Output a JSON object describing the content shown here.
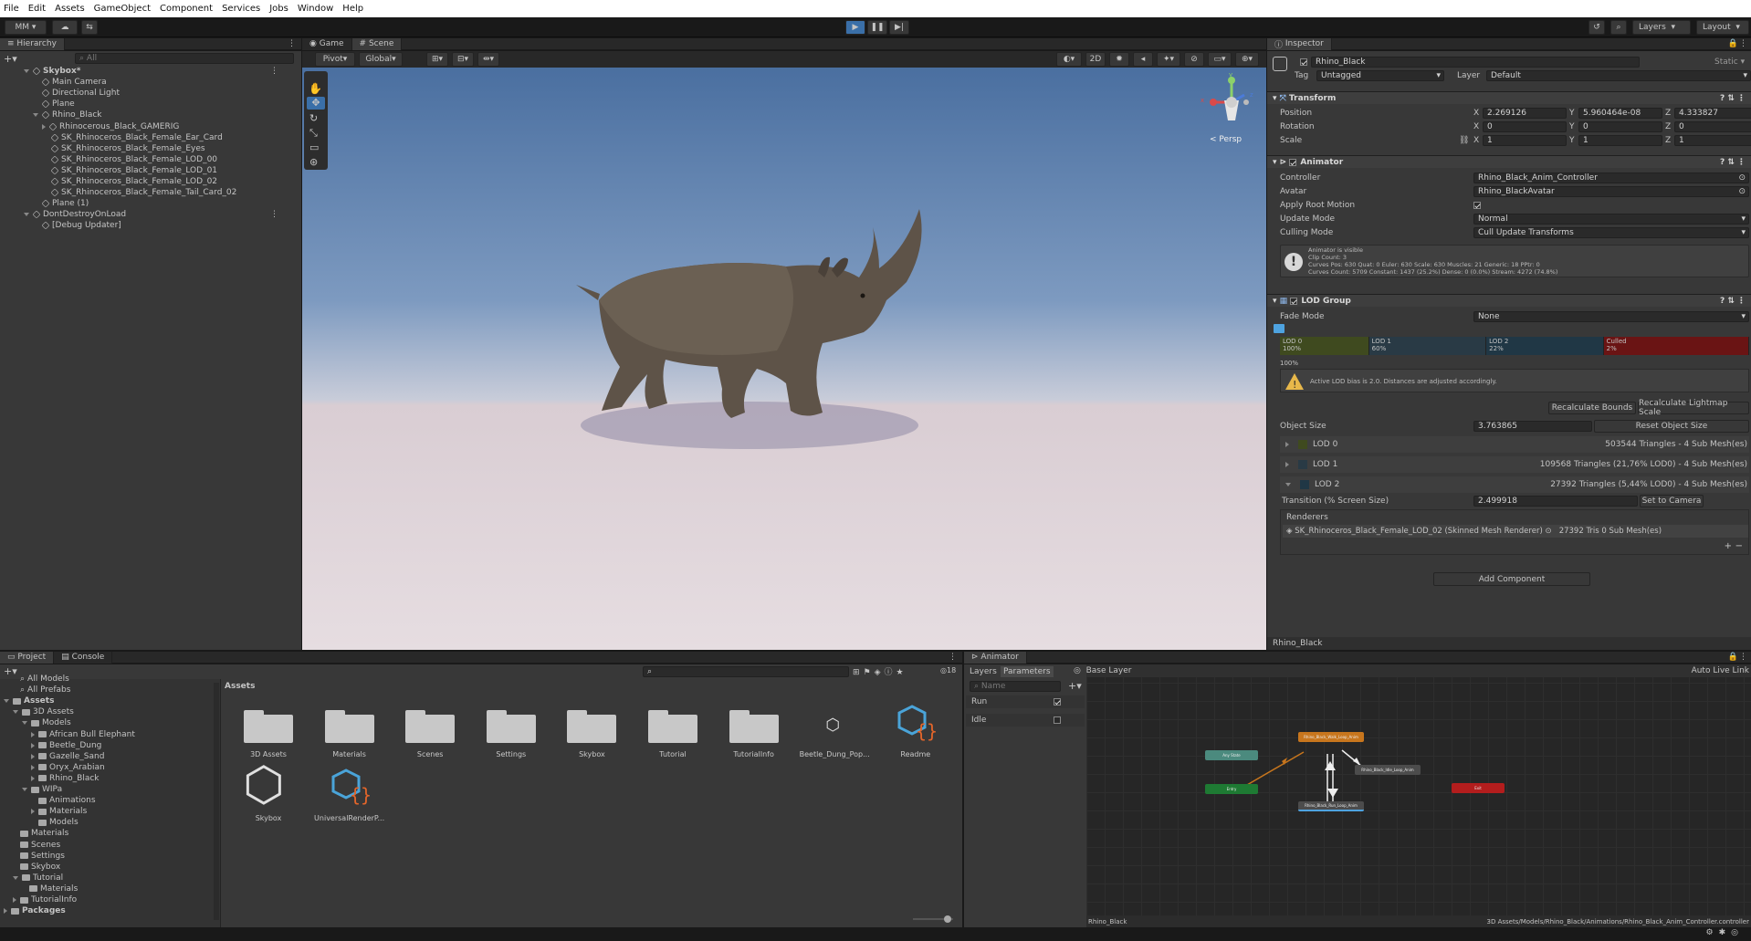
{
  "menu": [
    "File",
    "Edit",
    "Assets",
    "GameObject",
    "Component",
    "Services",
    "Jobs",
    "Window",
    "Help"
  ],
  "toolbar": {
    "account": "MM",
    "layers": "Layers",
    "layout": "Layout"
  },
  "hierarchy": {
    "tab": "Hierarchy",
    "search_placeholder": "All",
    "items": [
      {
        "label": "Skybox*",
        "depth": 0,
        "expand": "open",
        "bold": true,
        "icon": "scene-icon"
      },
      {
        "label": "Main Camera",
        "depth": 1
      },
      {
        "label": "Directional Light",
        "depth": 1
      },
      {
        "label": "Plane",
        "depth": 1
      },
      {
        "label": "Rhino_Black",
        "depth": 1,
        "expand": "open"
      },
      {
        "label": "Rhinocerous_Black_GAMERIG",
        "depth": 2,
        "expand": "closed"
      },
      {
        "label": "SK_Rhinoceros_Black_Female_Ear_Card",
        "depth": 2
      },
      {
        "label": "SK_Rhinoceros_Black_Female_Eyes",
        "depth": 2
      },
      {
        "label": "SK_Rhinoceros_Black_Female_LOD_00",
        "depth": 2
      },
      {
        "label": "SK_Rhinoceros_Black_Female_LOD_01",
        "depth": 2
      },
      {
        "label": "SK_Rhinoceros_Black_Female_LOD_02",
        "depth": 2
      },
      {
        "label": "SK_Rhinoceros_Black_Female_Tail_Card_02",
        "depth": 2
      },
      {
        "label": "Plane (1)",
        "depth": 1
      },
      {
        "label": "DontDestroyOnLoad",
        "depth": 0,
        "expand": "open",
        "icon": "scene-icon"
      },
      {
        "label": "[Debug Updater]",
        "depth": 1
      }
    ]
  },
  "scene": {
    "tabs": [
      "Game",
      "Scene"
    ],
    "pivot": "Pivot",
    "global": "Global",
    "mode2d": "2D",
    "persp": "< Persp",
    "gizmo": {
      "x": "x",
      "y": "y",
      "z": "z"
    }
  },
  "inspector": {
    "tab": "Inspector",
    "object_name": "Rhino_Black",
    "static": "Static",
    "tag_label": "Tag",
    "tag_value": "Untagged",
    "layer_label": "Layer",
    "layer_value": "Default",
    "transform": {
      "title": "Transform",
      "rows": [
        {
          "label": "Position",
          "x": "2.269126",
          "y": "5.960464e-08",
          "z": "4.333827"
        },
        {
          "label": "Rotation",
          "x": "0",
          "y": "0",
          "z": "0"
        },
        {
          "label": "Scale",
          "x": "1",
          "y": "1",
          "z": "1"
        }
      ],
      "axis": {
        "x": "X",
        "y": "Y",
        "z": "Z"
      }
    },
    "animator": {
      "title": "Animator",
      "rows": [
        {
          "label": "Controller",
          "value": "Rhino_Black_Anim_Controller"
        },
        {
          "label": "Avatar",
          "value": "Rhino_BlackAvatar"
        },
        {
          "label": "Apply Root Motion",
          "value": ""
        },
        {
          "label": "Update Mode",
          "value": "Normal"
        },
        {
          "label": "Culling Mode",
          "value": "Cull Update Transforms"
        }
      ],
      "info": [
        "Animator is visible",
        "Clip Count: 3",
        "Curves Pos: 630 Quat: 0 Euler: 630 Scale: 630 Muscles: 21 Generic: 18 PPtr: 0",
        "Curves Count: 5709 Constant: 1437 (25.2%) Dense: 0 (0.0%) Stream: 4272 (74.8%)"
      ]
    },
    "lod": {
      "title": "LOD Group",
      "fade_label": "Fade Mode",
      "fade_value": "None",
      "bars": [
        {
          "name": "LOD 0",
          "pct": "100%",
          "color": "#3f4a1f"
        },
        {
          "name": "LOD 1",
          "pct": "60%",
          "color": "#293a45"
        },
        {
          "name": "LOD 2",
          "pct": "22%",
          "color": "#203745"
        },
        {
          "name": "Culled",
          "pct": "2%",
          "color": "#6a1414"
        }
      ],
      "under_pct": "100%",
      "warning": "Active LOD bias is 2.0. Distances are adjusted accordingly.",
      "recalc_bounds": "Recalculate Bounds",
      "recalc_lightmap": "Recalculate Lightmap Scale",
      "object_size_label": "Object Size",
      "object_size": "3.763865",
      "reset_size": "Reset Object Size",
      "levels": [
        {
          "name": "LOD 0",
          "info": "503544 Triangles  - 4 Sub Mesh(es)",
          "swatch": "#3f4a1f"
        },
        {
          "name": "LOD 1",
          "info": "109568 Triangles (21,76% LOD0) - 4 Sub Mesh(es)",
          "swatch": "#293a45"
        },
        {
          "name": "LOD 2",
          "info": "27392 Triangles (5,44% LOD0) - 4 Sub Mesh(es)",
          "swatch": "#203745"
        }
      ],
      "transition_label": "Transition (% Screen Size)",
      "transition_value": "2.499918",
      "set_to_camera": "Set to Camera",
      "renderers_label": "Renderers",
      "renderer_name": "SK_Rhinoceros_Black_Female_LOD_02 (Skinned Mesh Renderer)",
      "renderer_info": "27392 Tris  0 Sub Mesh(es)"
    },
    "add_component": "Add Component",
    "footer": "Rhino_Black"
  },
  "project": {
    "tabs": [
      "Project",
      "Console"
    ],
    "badge": "18",
    "path": "Assets",
    "tree": [
      {
        "label": "All Models",
        "depth": 1,
        "icon": "search"
      },
      {
        "label": "All Prefabs",
        "depth": 1,
        "icon": "search"
      },
      {
        "label": "Assets",
        "depth": 0,
        "expand": "open",
        "bold": true
      },
      {
        "label": "3D Assets",
        "depth": 1,
        "expand": "open"
      },
      {
        "label": "Models",
        "depth": 2,
        "expand": "open"
      },
      {
        "label": "African Bull Elephant",
        "depth": 3,
        "expand": "closed"
      },
      {
        "label": "Beetle_Dung",
        "depth": 3,
        "expand": "closed"
      },
      {
        "label": "Gazelle_Sand",
        "depth": 3,
        "expand": "closed"
      },
      {
        "label": "Oryx_Arabian",
        "depth": 3,
        "expand": "closed"
      },
      {
        "label": "Rhino_Black",
        "depth": 3,
        "expand": "closed"
      },
      {
        "label": "WIPa",
        "depth": 2,
        "expand": "open"
      },
      {
        "label": "Animations",
        "depth": 3
      },
      {
        "label": "Materials",
        "depth": 3,
        "expand": "closed"
      },
      {
        "label": "Models",
        "depth": 3
      },
      {
        "label": "Materials",
        "depth": 1
      },
      {
        "label": "Scenes",
        "depth": 1
      },
      {
        "label": "Settings",
        "depth": 1
      },
      {
        "label": "Skybox",
        "depth": 1
      },
      {
        "label": "Tutorial",
        "depth": 1,
        "expand": "open"
      },
      {
        "label": "Materials",
        "depth": 2
      },
      {
        "label": "TutorialInfo",
        "depth": 1,
        "expand": "closed"
      },
      {
        "label": "Packages",
        "depth": 0,
        "expand": "closed",
        "bold": true
      }
    ],
    "assets": [
      {
        "label": "3D Assets",
        "kind": "folder"
      },
      {
        "label": "Materials",
        "kind": "folder"
      },
      {
        "label": "Scenes",
        "kind": "folder"
      },
      {
        "label": "Settings",
        "kind": "folder"
      },
      {
        "label": "Skybox",
        "kind": "folder"
      },
      {
        "label": "Tutorial",
        "kind": "folder"
      },
      {
        "label": "TutorialInfo",
        "kind": "folder"
      },
      {
        "label": "Beetle_Dung_Pop...",
        "kind": "unity"
      },
      {
        "label": "Readme",
        "kind": "script"
      },
      {
        "label": "Skybox",
        "kind": "unity-big"
      },
      {
        "label": "UniversalRenderP...",
        "kind": "script"
      }
    ]
  },
  "animator_window": {
    "tab": "Animator",
    "layers_tab": "Layers",
    "params_tab": "Parameters",
    "name_placeholder": "Name",
    "params": [
      {
        "label": "Run",
        "on": true
      },
      {
        "label": "Idle",
        "on": false
      }
    ],
    "base_layer": "Base Layer",
    "auto_live": "Auto Live Link",
    "footer_left": "Rhino_Black",
    "footer_right": "3D Assets/Models/Rhino_Black/Animations/Rhino_Black_Anim_Controller.controller",
    "nodes": [
      {
        "label": "Any State",
        "color": "#4b8a7e"
      },
      {
        "label": "Entry",
        "color": "#1e7a33"
      },
      {
        "label": "Rhino_Black_Walk_Loop_Anim",
        "color": "#c8761d"
      },
      {
        "label": "Rhino_Black_Idle_Loop_Anim",
        "color": "#4c4c4c"
      },
      {
        "label": "Rhino_Black_Run_Loop_Anim",
        "color": "#4c4c4c"
      },
      {
        "label": "Exit",
        "color": "#b31d1d"
      }
    ]
  }
}
